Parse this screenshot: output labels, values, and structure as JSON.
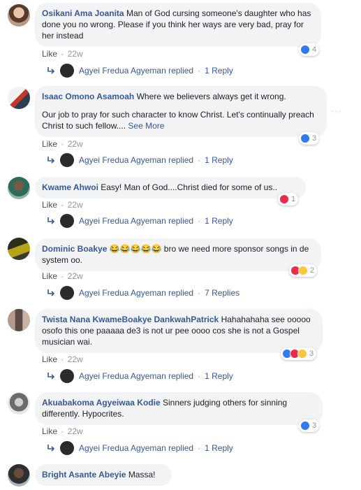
{
  "comments": [
    {
      "author": "Osikani Ama Joanita",
      "text": "Man of God cursing someone's daughter who has done you no wrong. Please if you think her ways are very bad, pray for her instead",
      "like": "Like",
      "time": "22w",
      "reaction_count": "4",
      "reply_author": "Agyei Fredua Agyeman replied",
      "reply_count": "1 Reply"
    },
    {
      "author": "Isaac Omono Asamoah",
      "text": "Where we believers always get it wrong.",
      "text2": "Our job to pray for such character to know Christ. Let's continually preach Christ to such fellow....",
      "see_more": "See More",
      "like": "Like",
      "time": "22w",
      "reaction_count": "3",
      "reply_author": "Agyei Fredua Agyeman replied",
      "reply_count": "1 Reply",
      "more_options": "···"
    },
    {
      "author": "Kwame Ahwoi",
      "text": "Easy! Man of God....Christ died for some of us..",
      "like": "Like",
      "time": "22w",
      "reaction_count": "1",
      "reply_author": "Agyei Fredua Agyeman replied",
      "reply_count": "1 Reply"
    },
    {
      "author": "Dominic Boakye",
      "text": "bro we need more sponsor songs in de system oo.",
      "emoji": "😂😂😂😂😂",
      "like": "Like",
      "time": "22w",
      "reaction_count": "2",
      "reply_author": "Agyei Fredua Agyeman replied",
      "reply_count": "7 Replies"
    },
    {
      "author": "Twista Nana KwameBoakye DankwahPatrick",
      "text": "Hahahahaha see ooooo osofo this one paaaaa de3 is not ur pee oooo cos she is not a Gospel musician wai.",
      "like": "Like",
      "time": "22w",
      "reaction_count": "3",
      "reply_author": "Agyei Fredua Agyeman replied",
      "reply_count": "1 Reply"
    },
    {
      "author": "Akuabakoma Agyeiwaa Kodie",
      "text": "Sinners judging others for sinning differently. Hypocrites.",
      "like": "Like",
      "time": "22w",
      "reaction_count": "3",
      "reply_author": "Agyei Fredua Agyeman replied",
      "reply_count": "1 Reply"
    },
    {
      "author": "Bright Asante Abeyie",
      "text": "Massa!"
    }
  ],
  "separator": "·",
  "colors": {
    "link": "#385898",
    "bubble": "#f2f3f5",
    "meta": "#90949c",
    "like_blue": "#2f7bf1",
    "love_red": "#f0294f",
    "haha_yellow": "#fbc739"
  }
}
